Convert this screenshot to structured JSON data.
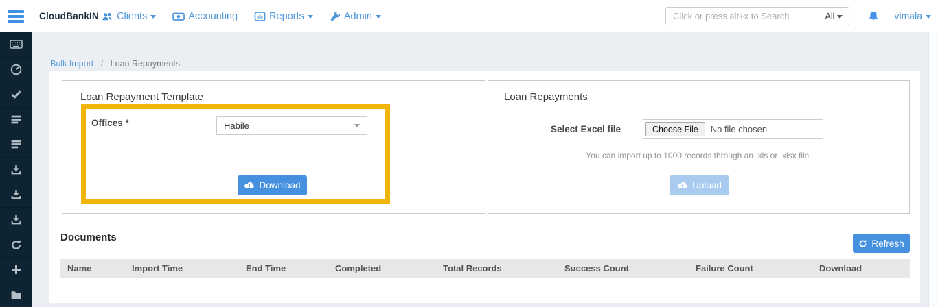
{
  "topbar": {
    "brand": "CloudBankIN",
    "nav": [
      {
        "label": "Clients",
        "icon": "users-icon",
        "caret": true
      },
      {
        "label": "Accounting",
        "icon": "money-icon",
        "caret": false
      },
      {
        "label": "Reports",
        "icon": "bar-chart-icon",
        "caret": true
      },
      {
        "label": "Admin",
        "icon": "wrench-icon",
        "caret": true
      }
    ],
    "search": {
      "placeholder": "Click or press alt+x to Search",
      "filter_value": "All"
    },
    "notifications_icon": "bell-icon",
    "user": "vimala"
  },
  "sidebar": {
    "items": [
      {
        "icon": "keyboard-icon"
      },
      {
        "icon": "gauge-icon"
      },
      {
        "icon": "check-icon"
      },
      {
        "icon": "rows-icon"
      },
      {
        "icon": "rows-icon"
      },
      {
        "icon": "import-tray-icon"
      },
      {
        "icon": "import-tray-icon"
      },
      {
        "icon": "import-tray-icon"
      },
      {
        "icon": "refresh-icon"
      },
      {
        "icon": "plus-icon"
      },
      {
        "icon": "folder-icon"
      }
    ]
  },
  "breadcrumb": {
    "parent": "Bulk Import",
    "separator": "/",
    "current": "Loan Repayments"
  },
  "template_panel": {
    "title": "Loan Repayment Template",
    "offices_label": "Offices *",
    "office_value": "Habile",
    "download_label": "Download"
  },
  "upload_panel": {
    "title": "Loan Repayments",
    "file_label": "Select Excel file",
    "choose_file_label": "Choose File",
    "no_file_text": "No file chosen",
    "helper_text": "You can import up to 1000 records through an .xls or .xlsx file.",
    "upload_label": "Upload"
  },
  "documents": {
    "title": "Documents",
    "refresh_label": "Refresh",
    "columns": [
      "Name",
      "Import Time",
      "End Time",
      "Completed",
      "Total Records",
      "Success Count",
      "Failure Count",
      "Download"
    ],
    "rows": []
  },
  "colors": {
    "accent_blue": "#4e97da",
    "primary_button": "#4590df",
    "disabled_button": "#a9cbf0",
    "highlight_yellow": "#f0b40a",
    "sidebar_bg": "#0e2433",
    "page_bg": "#ebeff3",
    "table_header_bg": "#e7e7e7"
  }
}
